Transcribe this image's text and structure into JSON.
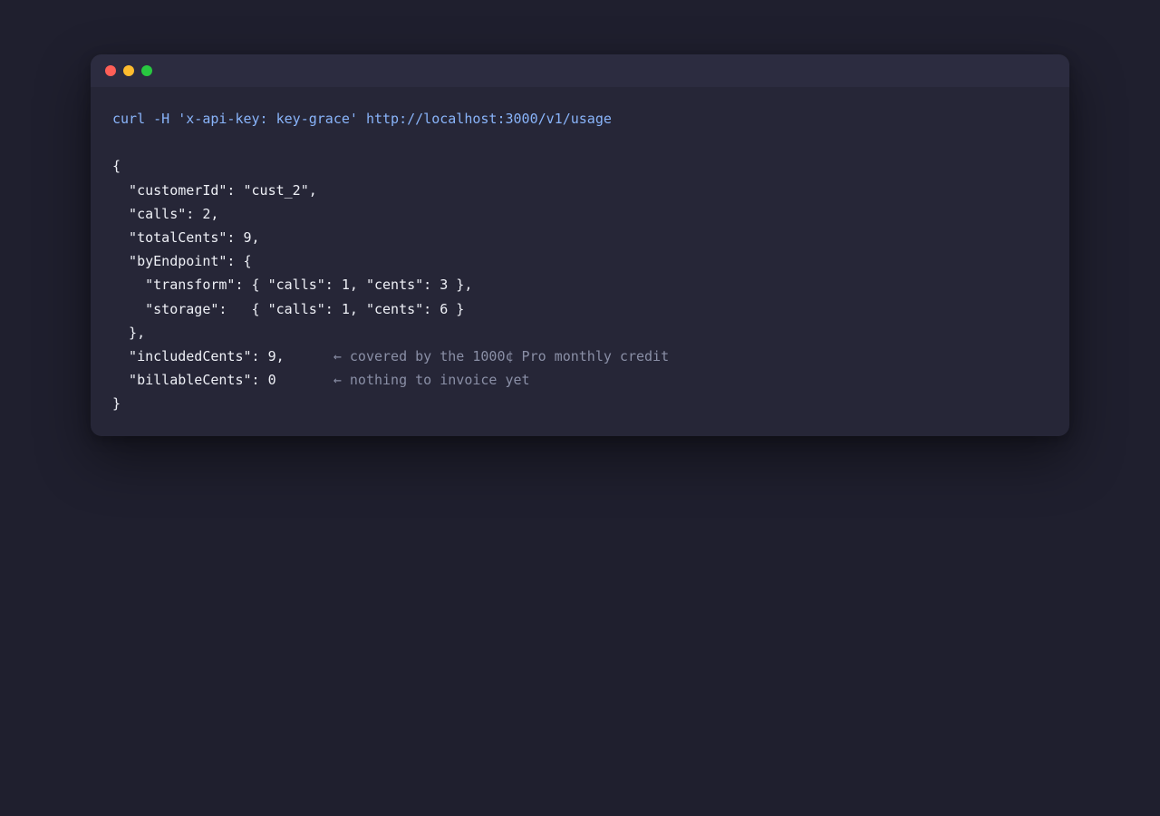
{
  "window": {
    "controls": {
      "close_color": "#ff5f57",
      "minimize_color": "#febc2e",
      "maximize_color": "#28c840"
    }
  },
  "terminal": {
    "command": "curl -H 'x-api-key: key-grace' http://localhost:3000/v1/usage",
    "output": [
      {
        "code": "{"
      },
      {
        "code": "  \"customerId\": \"cust_2\","
      },
      {
        "code": "  \"calls\": 2,"
      },
      {
        "code": "  \"totalCents\": 9,"
      },
      {
        "code": "  \"byEndpoint\": {"
      },
      {
        "code": "    \"transform\": { \"calls\": 1, \"cents\": 3 },"
      },
      {
        "code": "    \"storage\":   { \"calls\": 1, \"cents\": 6 }"
      },
      {
        "code": "  },"
      },
      {
        "code": "  \"includedCents\": 9,      ",
        "comment": "← covered by the 1000¢ Pro monthly credit"
      },
      {
        "code": "  \"billableCents\": 0       ",
        "comment": "← nothing to invoice yet"
      },
      {
        "code": "}"
      }
    ]
  },
  "colors": {
    "background": "#1f1f2e",
    "window": "#262637",
    "titlebar": "#2c2c40",
    "command": "#89b4fa",
    "text": "#eef0f6",
    "comment": "#8a8fa6"
  }
}
